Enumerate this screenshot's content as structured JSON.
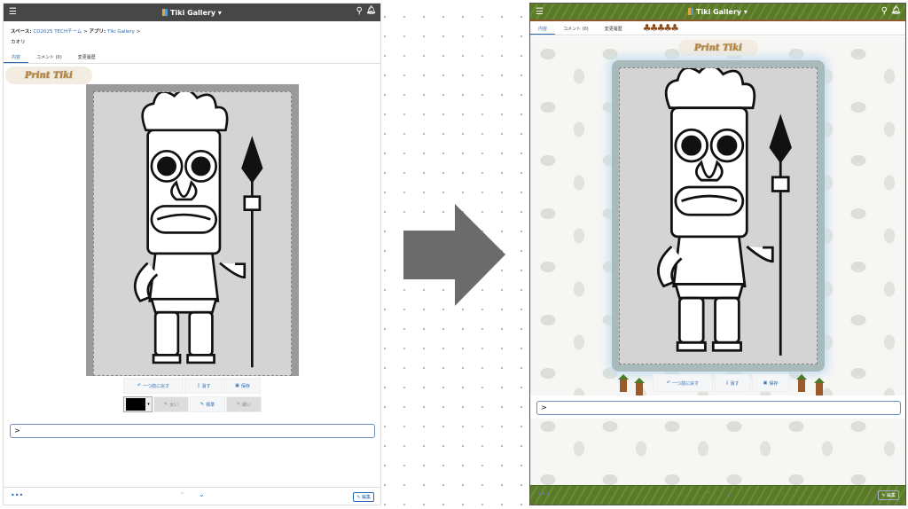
{
  "before": {
    "header": {
      "title": "Tiki Gallery"
    },
    "breadcrumb": {
      "space_prefix": "スペース: ",
      "space": "CD2025 TECHチーム",
      "sep": " > ",
      "app_prefix": "アプリ: ",
      "app": "Tiki Gallery"
    },
    "user": "カオリ",
    "tabs": [
      {
        "label": "内容"
      },
      {
        "label": "コメント (0)"
      },
      {
        "label": "変更履歴"
      }
    ],
    "banner": "Print Tiki",
    "toolbar": {
      "undo": "一つ前に戻す",
      "clear": "消す",
      "save": "保存",
      "thick": "太い",
      "normal": "標準",
      "thin": "細い",
      "color": "#000000"
    },
    "input_prompt": ">",
    "footer": {
      "more": "•••",
      "edit": "編集"
    }
  },
  "after": {
    "header": {
      "title": "Tiki Gallery"
    },
    "tabs": [
      {
        "label": "内容"
      },
      {
        "label": "コメント (0)"
      },
      {
        "label": "変更履歴"
      }
    ],
    "banner": "Print Tiki",
    "toolbar": {
      "undo": "一つ前に戻す",
      "clear": "消す",
      "save": "保存"
    },
    "input_prompt": ">",
    "footer": {
      "more": "•••",
      "edit": "編集"
    }
  },
  "colors": {
    "arrow": "#6b6b6b",
    "header_before": "#474747",
    "header_after": "#5a7a2a",
    "link": "#2a6ab0"
  }
}
